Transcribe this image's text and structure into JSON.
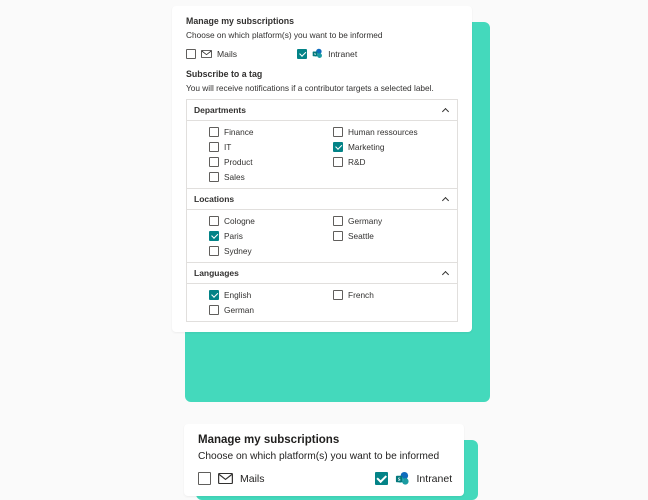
{
  "panel1": {
    "title": "Manage my subscriptions",
    "subtitle": "Choose on which platform(s) you want to be informed",
    "platforms": {
      "mails": {
        "label": "Mails",
        "checked": false
      },
      "intranet": {
        "label": "Intranet",
        "checked": true
      }
    },
    "subscribe_title": "Subscribe to a tag",
    "subscribe_sub": "You will receive notifications if a contributor targets a selected label.",
    "sections": {
      "departments": {
        "header": "Departments",
        "items": [
          {
            "label": "Finance",
            "checked": false
          },
          {
            "label": "Human ressources",
            "checked": false
          },
          {
            "label": "IT",
            "checked": false
          },
          {
            "label": "Marketing",
            "checked": true
          },
          {
            "label": "Product",
            "checked": false
          },
          {
            "label": "R&D",
            "checked": false
          },
          {
            "label": "Sales",
            "checked": false
          }
        ]
      },
      "locations": {
        "header": "Locations",
        "items": [
          {
            "label": "Cologne",
            "checked": false
          },
          {
            "label": "Germany",
            "checked": false
          },
          {
            "label": "Paris",
            "checked": true
          },
          {
            "label": "Seattle",
            "checked": false
          },
          {
            "label": "Sydney",
            "checked": false
          }
        ]
      },
      "languages": {
        "header": "Languages",
        "items": [
          {
            "label": "English",
            "checked": true
          },
          {
            "label": "French",
            "checked": false
          },
          {
            "label": "German",
            "checked": false
          }
        ]
      }
    }
  },
  "panel2": {
    "title": "Manage my subscriptions",
    "subtitle": "Choose on which platform(s) you want to be informed",
    "platforms": {
      "mails": {
        "label": "Mails",
        "checked": false
      },
      "intranet": {
        "label": "Intranet",
        "checked": true
      }
    }
  },
  "colors": {
    "accent": "#038387",
    "teal_shadow": "#44d9bc",
    "border": "#e1dfdd"
  }
}
